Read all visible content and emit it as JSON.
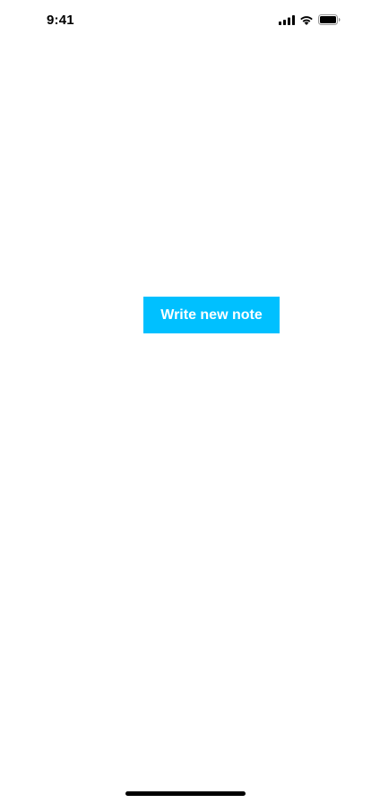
{
  "status_bar": {
    "time": "9:41",
    "icons": [
      "cellular-signal-icon",
      "wifi-icon",
      "battery-icon"
    ]
  },
  "main": {
    "write_button_label": "Write new note"
  },
  "colors": {
    "accent": "#00c0ff",
    "background": "#ffffff",
    "text_on_accent": "#ffffff"
  }
}
